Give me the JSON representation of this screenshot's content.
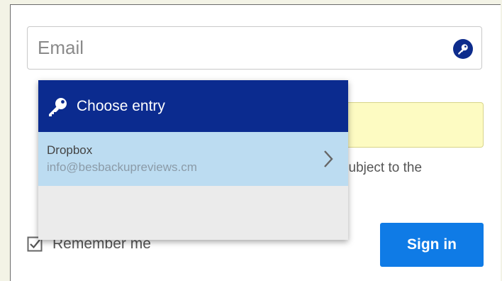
{
  "email_field": {
    "placeholder": "Email",
    "value": "",
    "icon": "key-icon"
  },
  "autofill_popup": {
    "header_icon": "key-icon",
    "title": "Choose entry",
    "entries": [
      {
        "name": "Dropbox",
        "login": "info@besbackupreviews.cm",
        "icon": "chevron-right-icon"
      }
    ]
  },
  "terms_fragment": "subject to the",
  "remember_me": {
    "label": "Remember me",
    "checked": true
  },
  "sign_in_label": "Sign in",
  "colors": {
    "popup_header": "#0b2b8f",
    "entry_highlight": "#bcdcf1",
    "password_autofill": "#fdfbc2",
    "primary_button": "#0f7be6"
  }
}
